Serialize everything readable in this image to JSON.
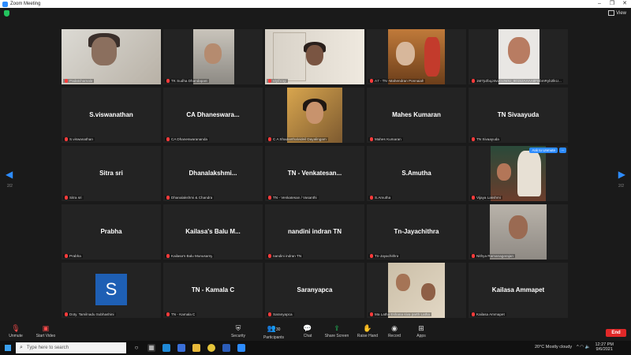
{
  "window": {
    "title": "Zoom Meeting",
    "controls": [
      "–",
      "❐",
      "✕"
    ]
  },
  "header": {
    "view_label": "View"
  },
  "nav": {
    "left_arrow": "◀",
    "right_arrow": "▶",
    "page_left": "2/2",
    "page_right": "2/2"
  },
  "tiles": [
    {
      "caption": "Padatchamala",
      "name": "",
      "video": "v1"
    },
    {
      "caption": "TK Sudha Dhandapani",
      "name": "",
      "video": "v2"
    },
    {
      "caption": "Mythrayi",
      "name": "",
      "video": "v3",
      "active": true
    },
    {
      "caption": "A7 - TN -Mahendran Ponnaiah",
      "name": "",
      "video": "v4"
    },
    {
      "caption": "1M7pZbqJ4vuGcN0U_90152AAAA8FBbmRyb2lkU...",
      "name": "",
      "video": "v5"
    },
    {
      "caption": "S.viswanathan",
      "name": "S.viswanathan"
    },
    {
      "caption": "CA Dhaneswarananda",
      "name": "CA  Dhaneswara..."
    },
    {
      "caption": "C A Shadanthalvideil Dayalingam",
      "name": "",
      "video": "v8"
    },
    {
      "caption": "Mahes Kumaran",
      "name": "Mahes Kumaran"
    },
    {
      "caption": "TN Sivaayuda",
      "name": "TN Sivaayuda"
    },
    {
      "caption": "Sitra sri",
      "name": "Sitra sri"
    },
    {
      "caption": "Dhanalakshmi  & Chandra",
      "name": "Dhanalakshmi..."
    },
    {
      "caption": "TN - Venkatesan / Vasanthi",
      "name": "TN  -  Venkatesan..."
    },
    {
      "caption": "S.Amutha",
      "name": "S.Amutha"
    },
    {
      "caption": "Vijaya Lakshmi",
      "name": "",
      "video": "v15",
      "ask": "Ask to Unmute",
      "more": "..."
    },
    {
      "caption": "Prabha",
      "name": "Prabha"
    },
    {
      "caption": "Kailasa's Balu Munusamy",
      "name": "Kailasa's  Balu  M..."
    },
    {
      "caption": "nandini indran TN",
      "name": "nandini indran TN"
    },
    {
      "caption": "Tn-Jayachithra",
      "name": "Tn-Jayachithra"
    },
    {
      "caption": "Nithya Ramanagarajan",
      "name": "",
      "video": "v20"
    },
    {
      "caption": "Doty. Tamilnadu Subhashini",
      "name": "",
      "avatar": "S"
    },
    {
      "caption": "TN - Kamala C",
      "name": "TN  -  Kamala  C"
    },
    {
      "caption": "Saranyapca",
      "name": "Saranyapca"
    },
    {
      "caption": "Ma Latha Eshana siva parth Latha",
      "name": "",
      "video": "v24"
    },
    {
      "caption": "Kailasa Ammapet",
      "name": "Kailasa  Ammapet"
    }
  ],
  "toolbar": {
    "unmute": "Unmute",
    "start_video": "Start Video",
    "security": "Security",
    "participants": "Participants",
    "participants_count": "30",
    "chat": "Chat",
    "share_screen": "Share Screen",
    "raise_hand": "Raise Hand",
    "record": "Record",
    "apps": "Apps",
    "end": "End"
  },
  "taskbar": {
    "search_placeholder": "Type here to search",
    "weather": "20°C  Mostly cloudy",
    "time": "12:27 PM",
    "date": "9/6/2021"
  }
}
